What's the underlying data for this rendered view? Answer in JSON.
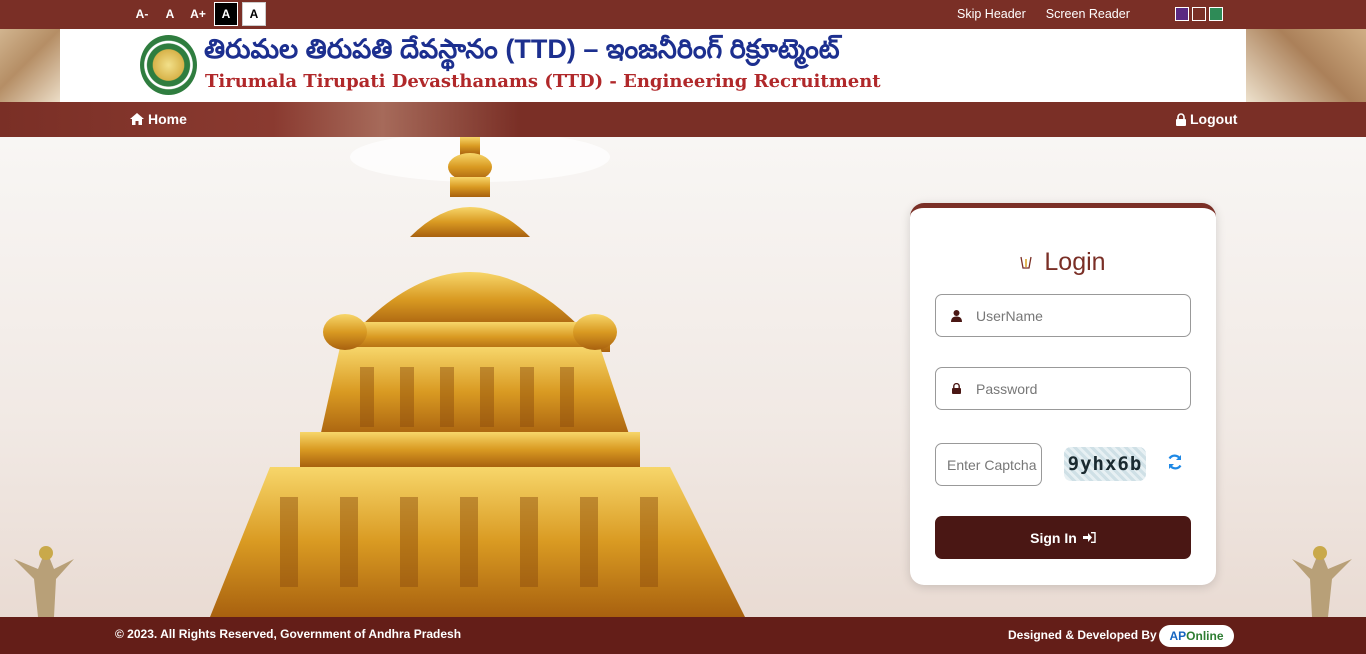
{
  "topbar": {
    "font_controls": [
      "A-",
      "A",
      "A+",
      "A",
      "A"
    ],
    "skip_header": "Skip Header",
    "screen_reader": "Screen Reader",
    "theme_colors": [
      "#5a2a82",
      "#7a2f26",
      "#2e8b57"
    ]
  },
  "header": {
    "title_telugu": "తిరుమల తిరుపతి దేవస్థానం (TTD) – ఇంజనీరింగ్ రిక్రూట్మెంట్",
    "title_english": "Tirumala Tirupati Devasthanams (TTD) -  Engineering Recruitment"
  },
  "nav": {
    "home": "Home",
    "logout": "Logout"
  },
  "login": {
    "title": "Login",
    "username_placeholder": "UserName",
    "password_placeholder": "Password",
    "captcha_placeholder": "Enter Captcha",
    "captcha_text": "9yhx6b",
    "signin": "Sign In"
  },
  "footer": {
    "copyright": "© 2023. All Rights Reserved, Government of Andhra Pradesh",
    "designed_by": "Designed & Developed By",
    "brand_ap": "AP",
    "brand_online": "Online"
  },
  "colors": {
    "brand_maroon": "#7a2f26",
    "button_dark": "#4a1714",
    "footer": "#641e18",
    "title_blue": "#1c2f8f",
    "title_red": "#b0282a"
  }
}
